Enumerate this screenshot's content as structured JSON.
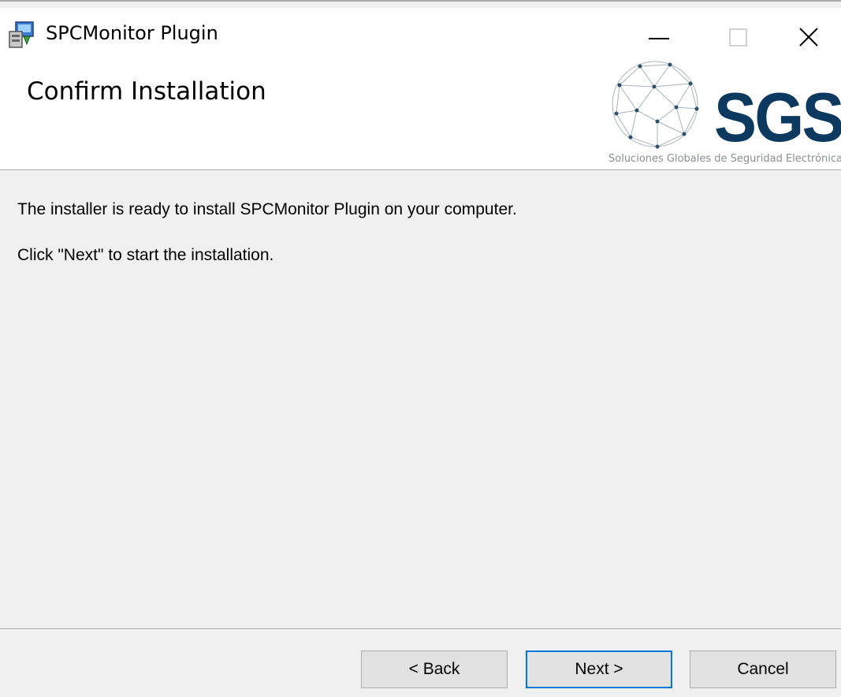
{
  "window": {
    "title": "SPCMonitor Plugin",
    "controls": {
      "minimize": "minimize-icon",
      "maximize": "maximize-icon",
      "close": "close-icon"
    }
  },
  "header": {
    "title": "Confirm Installation",
    "logo": {
      "text": "SGSE",
      "tagline": "Soluciones Globales de Seguridad Electrónica",
      "color": "#0b3960"
    }
  },
  "body": {
    "line1": "The installer is ready to install SPCMonitor Plugin on your computer.",
    "line2": "Click \"Next\" to start the installation."
  },
  "buttons": {
    "back": "< Back",
    "next": "Next >",
    "cancel": "Cancel"
  },
  "colors": {
    "accent": "#0078d7",
    "dialog_bg": "#f0f0f0",
    "button_bg": "#e1e1e1"
  }
}
